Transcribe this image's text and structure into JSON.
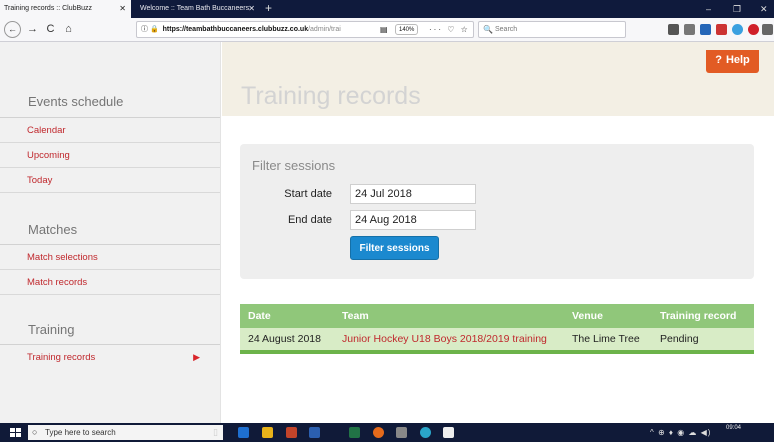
{
  "browser": {
    "tabs": [
      {
        "title": "Training records :: ClubBuzz",
        "close": "✕"
      },
      {
        "title": "Welcome :: Team Bath Buccaneers",
        "close": "✕"
      }
    ],
    "new_tab": "+",
    "window_controls": {
      "minimize": "–",
      "maximize": "❐",
      "close": "✕"
    },
    "nav": {
      "back": "←",
      "forward": "→",
      "reload": "C",
      "home": "⌂"
    },
    "url": {
      "info": "ⓘ",
      "lock": "🔒",
      "host": "https://teambathbuccaneers.clubbuzz.co.uk",
      "path": "/admin/trai"
    },
    "reader": "▤",
    "zoom": "140%",
    "page_actions": "··· ♡ ☆",
    "search_placeholder": "Search",
    "search_icon": "🔍"
  },
  "sidebar": {
    "sections": [
      {
        "title": "Events schedule",
        "items": [
          "Calendar",
          "Upcoming",
          "Today"
        ]
      },
      {
        "title": "Matches",
        "items": [
          "Match selections",
          "Match records"
        ]
      },
      {
        "title": "Training",
        "items": [
          "Training records"
        ]
      }
    ],
    "active_arrow": "▶"
  },
  "header": {
    "title": "Training records",
    "help_label": "Help",
    "help_mark": "?"
  },
  "filter": {
    "title": "Filter sessions",
    "start_label": "Start date",
    "start_value": "24 Jul 2018",
    "end_label": "End date",
    "end_value": "24 Aug 2018",
    "button_label": "Filter sessions"
  },
  "table": {
    "headers": [
      "Date",
      "Team",
      "Venue",
      "Training record"
    ],
    "rows": [
      [
        "24 August 2018",
        "Junior Hockey U18 Boys 2018/2019 training",
        "The Lime Tree",
        "Pending"
      ]
    ]
  },
  "taskbar": {
    "search_placeholder": "Type here to search",
    "tray": "^ ⊕ ♦ ◉ ☁ ◀)",
    "time": "09:04"
  },
  "colors": {
    "accent_red": "#c0282d",
    "help_orange": "#e25b24",
    "button_blue": "#1b89cf",
    "table_header_green": "#90c77a",
    "table_row_green": "#d8ecc6"
  }
}
